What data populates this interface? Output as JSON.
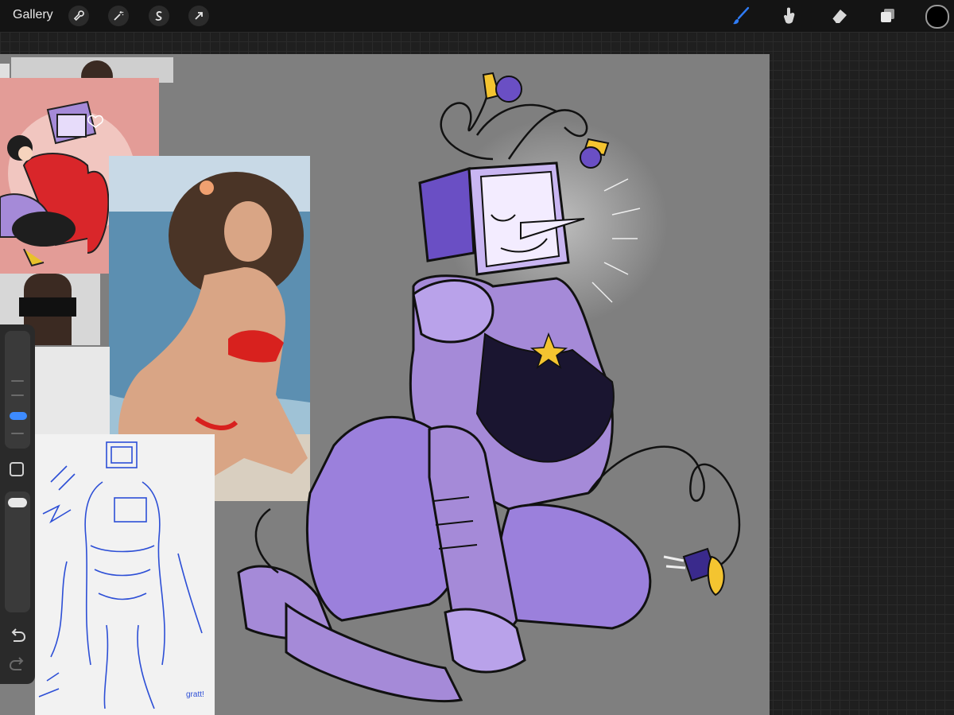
{
  "topbar": {
    "gallery_label": "Gallery",
    "left_tools": [
      {
        "name": "actions",
        "icon": "wrench-icon"
      },
      {
        "name": "adjustments",
        "icon": "magic-wand-icon"
      },
      {
        "name": "selection",
        "icon": "selection-s-icon"
      },
      {
        "name": "transform",
        "icon": "arrow-cursor-icon"
      }
    ],
    "right_tools": [
      {
        "name": "brush",
        "icon": "brush-icon",
        "active": true
      },
      {
        "name": "smudge",
        "icon": "smudge-finger-icon"
      },
      {
        "name": "eraser",
        "icon": "eraser-icon"
      },
      {
        "name": "layers",
        "icon": "layers-icon"
      }
    ],
    "current_color": "#000000",
    "active_tool_color": "#2f7cf6"
  },
  "sidebar": {
    "brush_size_level": 0.5,
    "brush_opacity_level": 1.0,
    "icons": [
      "square-modify-icon",
      "undo-icon",
      "redo-icon"
    ]
  },
  "canvas": {
    "background": "#7f7f7f",
    "sketch_note": "gratt!"
  }
}
